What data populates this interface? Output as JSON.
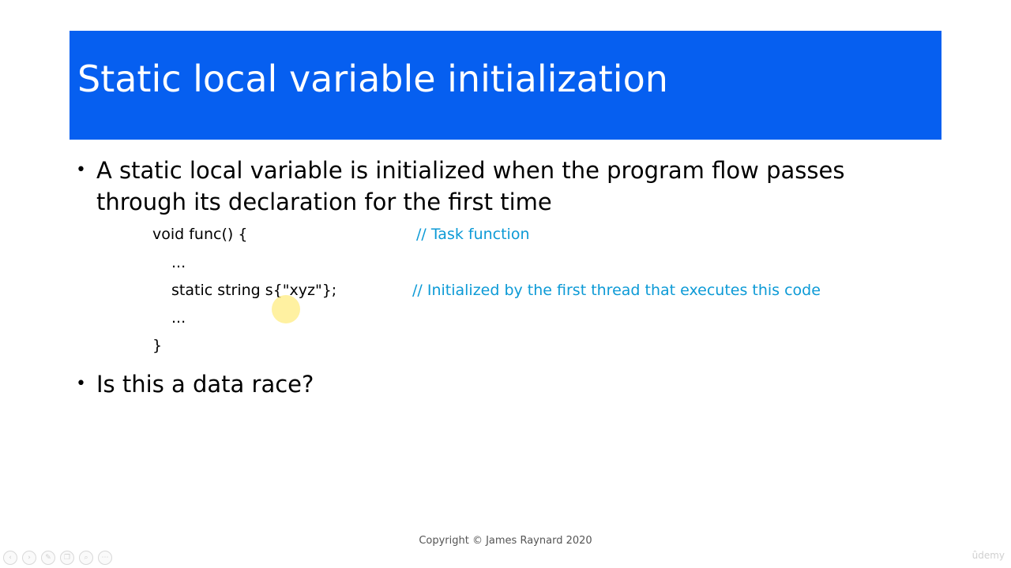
{
  "slide": {
    "title": "Static local variable initialization",
    "bullets": [
      "A static local variable is initialized when the program flow passes through its declaration for the first time",
      "Is this a data race?"
    ],
    "bullet_symbol": "•",
    "code": {
      "line1": "void func() {",
      "line2": "...",
      "line3": "static string s{\"xyz\"};",
      "line4": "...",
      "line5": "}"
    },
    "comments": {
      "task": "// Task function",
      "init": "// Initialized by the first thread that executes this code"
    },
    "footer": "Copyright © James Raynard 2020"
  },
  "player": {
    "controls": [
      "prev-icon",
      "next-icon",
      "pen-icon",
      "copy-icon",
      "zoom-icon",
      "more-icon"
    ],
    "control_glyphs": [
      "‹",
      "›",
      "✎",
      "❐",
      "⌕",
      "⋯"
    ]
  },
  "watermark": "ûdemy",
  "colors": {
    "title_bar": "#065ff0",
    "comment": "#0c9ad6",
    "cursor_highlight": "#ffec82"
  }
}
